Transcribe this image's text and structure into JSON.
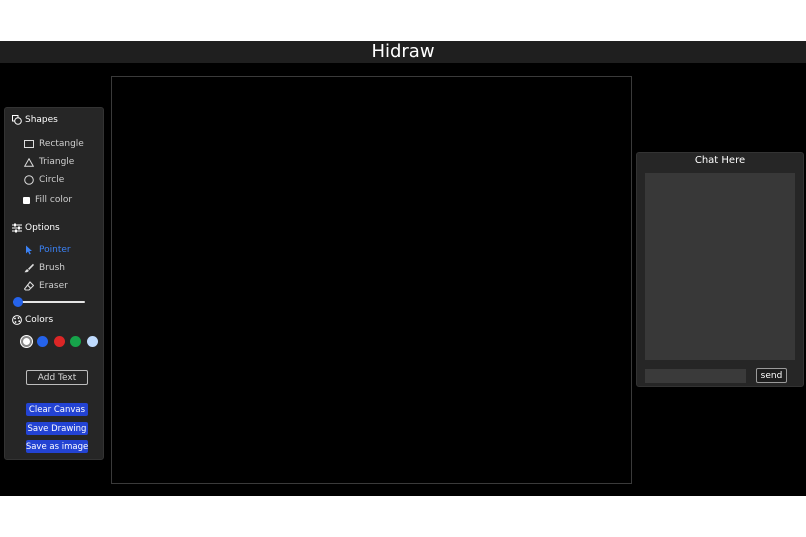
{
  "app": {
    "title": "Hidraw"
  },
  "tools": {
    "shapes_heading": "Shapes",
    "shapes": [
      "Rectangle",
      "Triangle",
      "Circle"
    ],
    "fill_color_label": "Fill color",
    "fill_color_checked": false,
    "options_heading": "Options",
    "options": [
      {
        "label": "Pointer",
        "active": true
      },
      {
        "label": "Brush",
        "active": false
      },
      {
        "label": "Eraser",
        "active": false
      }
    ],
    "brush_size_fraction": 0.0,
    "colors_heading": "Colors",
    "colors": [
      "#ffffff",
      "#2563eb",
      "#dc2626",
      "#16a34a",
      "#bfdbfe"
    ],
    "selected_color": "#ffffff",
    "add_text_label": "Add Text",
    "clear_canvas_label": "Clear Canvas",
    "save_drawing_label": "Save Drawing",
    "save_image_label": "Save as image"
  },
  "chat": {
    "title": "Chat Here",
    "input_value": "",
    "send_label": "send"
  }
}
